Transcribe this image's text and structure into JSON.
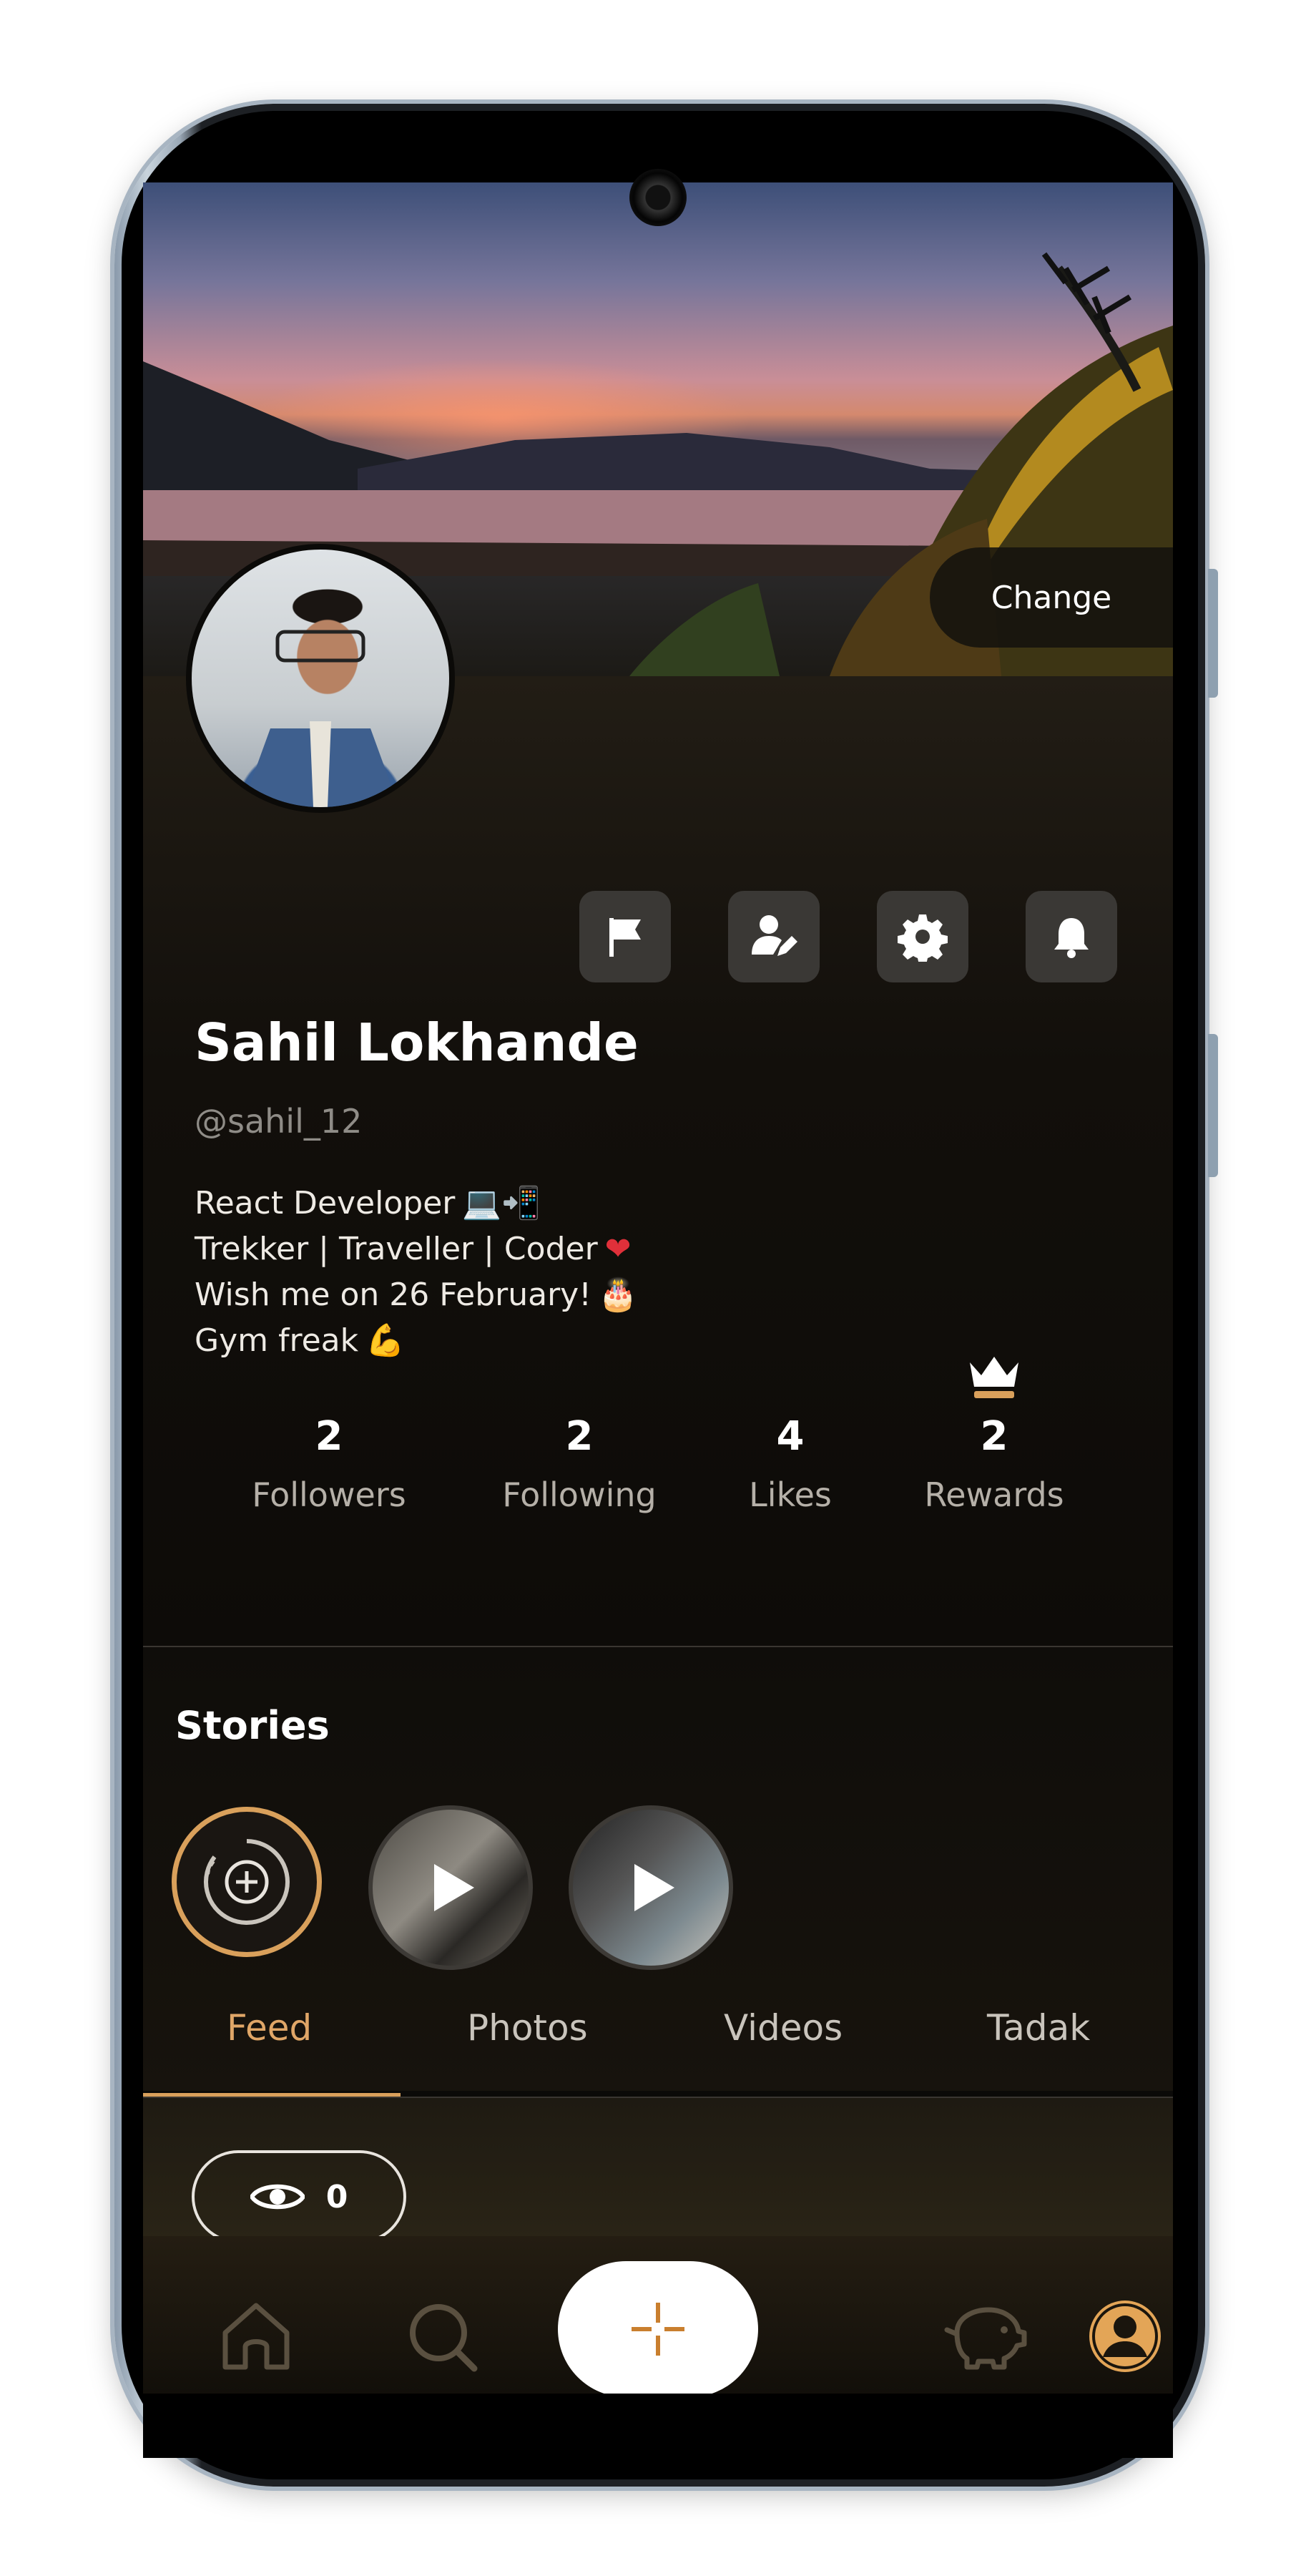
{
  "cover": {
    "change_label": "Change"
  },
  "profile": {
    "name": "Sahil Lokhande",
    "handle": "@sahil_12",
    "bio": [
      {
        "text": "React Developer",
        "emoji": "💻📲"
      },
      {
        "text": "Trekker | Traveller | Coder",
        "emoji": "❤"
      },
      {
        "text": "Wish me on 26 February!",
        "emoji": "🎂"
      },
      {
        "text": "Gym freak",
        "emoji": "💪"
      }
    ]
  },
  "actions": [
    {
      "name": "flag-icon"
    },
    {
      "name": "edit-profile-icon"
    },
    {
      "name": "settings-gear-icon"
    },
    {
      "name": "notification-bell-icon"
    }
  ],
  "stats": [
    {
      "value": "2",
      "label": "Followers"
    },
    {
      "value": "2",
      "label": "Following"
    },
    {
      "value": "4",
      "label": "Likes"
    },
    {
      "value": "2",
      "label": "Rewards"
    }
  ],
  "stories": {
    "title": "Stories"
  },
  "tabs": [
    {
      "label": "Feed",
      "active": true
    },
    {
      "label": "Photos",
      "active": false
    },
    {
      "label": "Videos",
      "active": false
    },
    {
      "label": "Tadak",
      "active": false
    }
  ],
  "feed": {
    "views_count": "0"
  },
  "colors": {
    "accent": "#d9a05b",
    "background": "#0b0a08",
    "icon_button": "#3a3835"
  },
  "nav": [
    "home-icon",
    "search-icon",
    "add-icon",
    "piggy-bank-icon",
    "profile-icon"
  ]
}
